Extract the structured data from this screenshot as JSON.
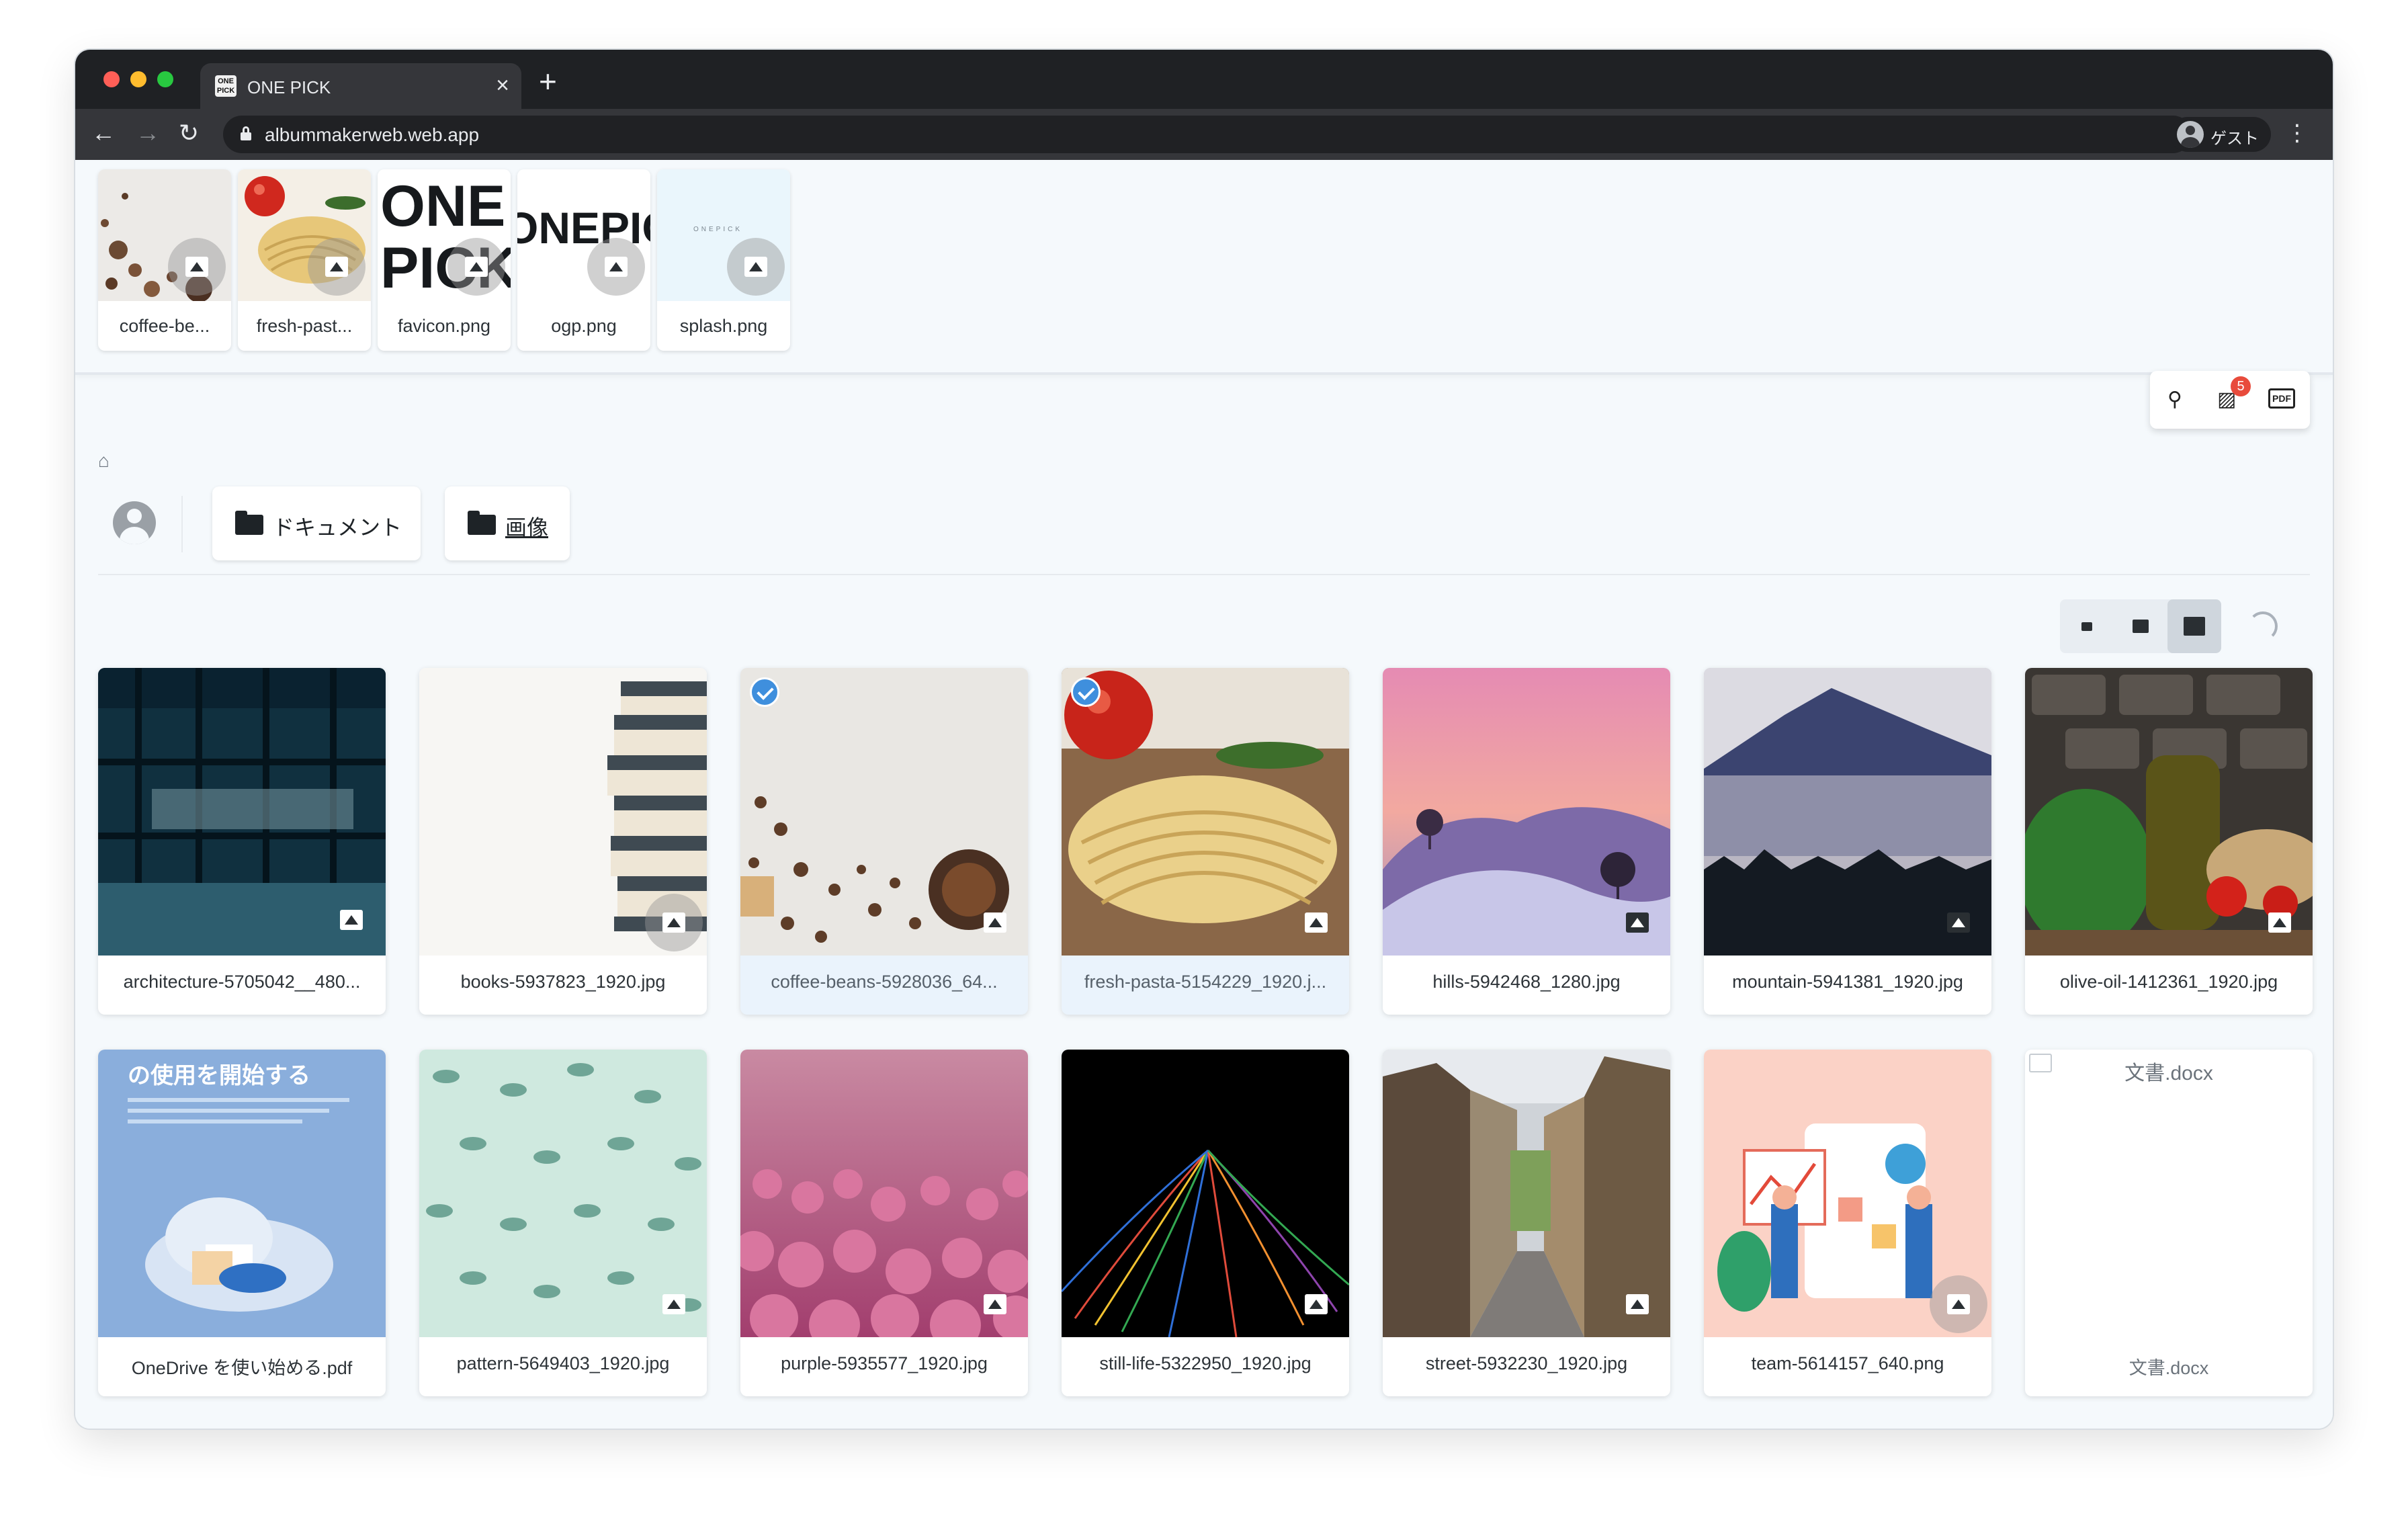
{
  "browser": {
    "tab_title": "ONE PICK",
    "tab_favicon": "ONE PICK",
    "url": "albummakerweb.web.app",
    "profile_label": "ゲスト"
  },
  "tray": {
    "items": [
      {
        "name": "coffee-be..."
      },
      {
        "name": "fresh-past..."
      },
      {
        "name": "favicon.png",
        "logo_text": "ONE PICK"
      },
      {
        "name": "ogp.png",
        "logo_text": "ONEPIC"
      },
      {
        "name": "splash.png",
        "logo_text": "ONEPICK"
      }
    ]
  },
  "toolbar_float": {
    "pin_icon": "pin-icon",
    "images_icon": "images-icon",
    "images_badge": "5",
    "pdf_icon": "pdf-icon",
    "pdf_label": "PDF"
  },
  "breadcrumb": {
    "home_icon": "home-icon"
  },
  "folders": [
    {
      "label": "ドキュメント"
    },
    {
      "label": "画像"
    }
  ],
  "view_sizes": [
    "small",
    "medium",
    "large"
  ],
  "files": [
    {
      "name": "architecture-5705042__480...",
      "selected": false
    },
    {
      "name": "books-5937823_1920.jpg",
      "selected": false
    },
    {
      "name": "coffee-beans-5928036_64...",
      "selected": true
    },
    {
      "name": "fresh-pasta-5154229_1920.j...",
      "selected": true
    },
    {
      "name": "hills-5942468_1280.jpg",
      "selected": false
    },
    {
      "name": "mountain-5941381_1920.jpg",
      "selected": false
    },
    {
      "name": "olive-oil-1412361_1920.jpg",
      "selected": false
    },
    {
      "name": "OneDrive を使い始める.pdf",
      "selected": false,
      "thumb_title": "の使用を開始する"
    },
    {
      "name": "pattern-5649403_1920.jpg",
      "selected": false
    },
    {
      "name": "purple-5935577_1920.jpg",
      "selected": false
    },
    {
      "name": "still-life-5322950_1920.jpg",
      "selected": false
    },
    {
      "name": "street-5932230_1920.jpg",
      "selected": false
    },
    {
      "name": "team-5614157_640.png",
      "selected": false
    },
    {
      "name": "文書.docx",
      "selected": false,
      "broken_alt": "文書.docx"
    }
  ],
  "colors": {
    "accent": "#3f8fdd",
    "badge": "#e84b3c",
    "chrome": "#1f2124",
    "background": "#f5f9fc"
  }
}
